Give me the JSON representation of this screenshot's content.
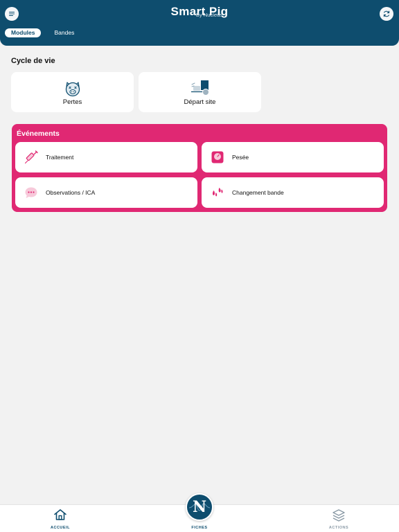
{
  "header": {
    "title": "Smart Pig",
    "subtitle": "By Nucleus",
    "menu_icon": "hamburger-icon",
    "sync_icon": "sync-icon"
  },
  "tabs": [
    {
      "label": "Modules",
      "active": true
    },
    {
      "label": "Bandes",
      "active": false
    }
  ],
  "cycle": {
    "title": "Cycle de vie",
    "cards": [
      {
        "label": "Pertes",
        "icon": "pig-face-icon"
      },
      {
        "label": "Départ site",
        "icon": "truck-departure-icon"
      }
    ]
  },
  "events": {
    "title": "Événements",
    "cards": [
      {
        "label": "Traitement",
        "icon": "syringe-icon"
      },
      {
        "label": "Pesée",
        "icon": "scale-icon"
      },
      {
        "label": "Observations / ICA",
        "icon": "chat-bubble-icon"
      },
      {
        "label": "Changement bande",
        "icon": "hooves-icon"
      }
    ]
  },
  "nav": {
    "accueil": "ACCUEIL",
    "fiches": "FICHES",
    "fiches_letter": "N",
    "actions": "ACTIONS"
  },
  "colors": {
    "primary": "#0e4d6e",
    "accent": "#e02873",
    "background": "#f2f2f2"
  }
}
